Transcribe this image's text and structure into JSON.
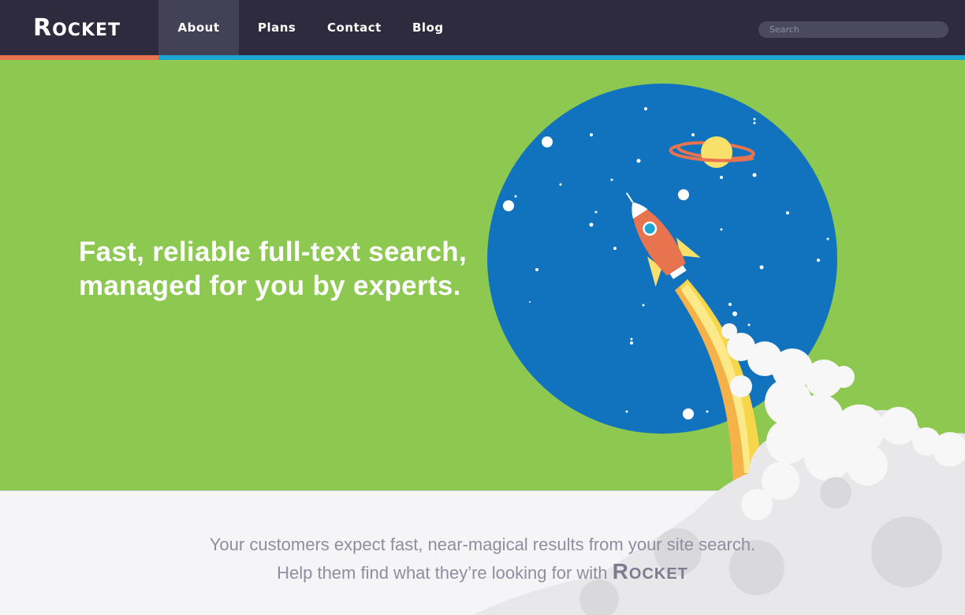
{
  "nav": {
    "logo_first": "R",
    "logo_rest": "OCKET",
    "links": [
      {
        "label": "About",
        "active": true
      },
      {
        "label": "Plans",
        "active": false
      },
      {
        "label": "Contact",
        "active": false
      },
      {
        "label": "Blog",
        "active": false
      }
    ],
    "search_placeholder": "Search"
  },
  "hero": {
    "title_line1": "Fast, reliable full-text search,",
    "title_line2": "managed for you by experts.",
    "illustration": "rocket-launch-icon"
  },
  "tagline": {
    "line1": "Your customers expect fast, near-magical results from your site search.",
    "line2": "Help them find what they’re looking for with",
    "brand_first": "R",
    "brand_rest": "OCKET"
  },
  "colors": {
    "nav_bg": "#2d2b3d",
    "nav_active": "#434156",
    "accent_orange": "#e8734f",
    "accent_blue": "#1ea5d6",
    "hero_green": "#8dc850",
    "space_blue": "#1173bd",
    "text_muted": "#8f8da0"
  }
}
